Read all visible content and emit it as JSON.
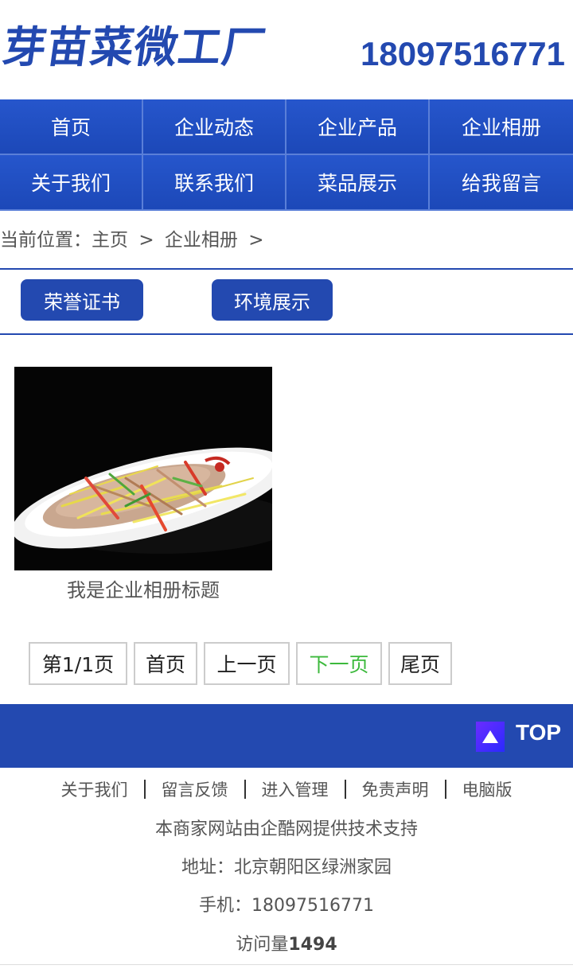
{
  "header": {
    "logo_text": "芽苗菜微工厂",
    "phone": "18097516771"
  },
  "nav": {
    "items": [
      {
        "label": "首页"
      },
      {
        "label": "企业动态"
      },
      {
        "label": "企业产品"
      },
      {
        "label": "企业相册"
      },
      {
        "label": "关于我们"
      },
      {
        "label": "联系我们"
      },
      {
        "label": "菜品展示"
      },
      {
        "label": "给我留言"
      }
    ]
  },
  "breadcrumb": {
    "prefix": "当前位置：",
    "home": "主页",
    "sep1": ">",
    "current": "企业相册",
    "sep2": ">"
  },
  "categories": [
    {
      "label": "荣誉证书"
    },
    {
      "label": "环境展示"
    }
  ],
  "album": {
    "items": [
      {
        "title": "我是企业相册标题",
        "image": "stir-fried-tofu-skin-dish"
      }
    ]
  },
  "pager": {
    "status": "第1/1页",
    "first": "首页",
    "prev": "上一页",
    "next": "下一页",
    "last": "尾页",
    "next_color": "#3cb93c"
  },
  "topbar": {
    "label": "TOP",
    "icon": "arrow-up-icon",
    "bg_color": "#2349b0"
  },
  "footer": {
    "links": [
      {
        "label": "关于我们"
      },
      {
        "label": "留言反馈"
      },
      {
        "label": "进入管理"
      },
      {
        "label": "免责声明"
      },
      {
        "label": "电脑版"
      }
    ],
    "support": "本商家网站由企酷网提供技术支持",
    "address": "地址：北京朝阳区绿洲家园",
    "mobile": "手机：18097516771",
    "visits_label": "访问量",
    "visits_count": "1494"
  },
  "colors": {
    "brand": "#2349b0",
    "nav_bg": "#1f4fc4"
  }
}
